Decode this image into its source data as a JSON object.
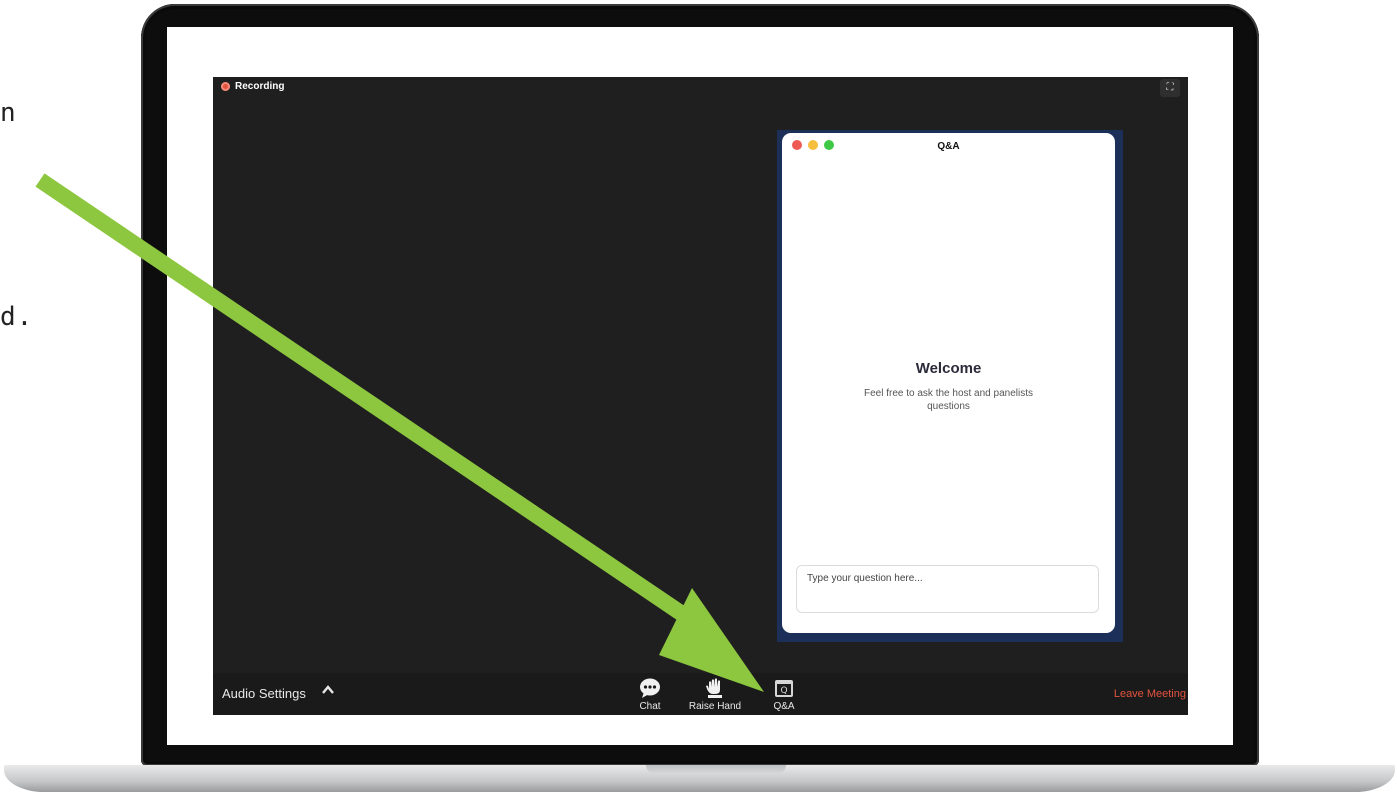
{
  "side_text": {
    "line1": "n",
    "line2": "d."
  },
  "zoom": {
    "recording_label": "Recording",
    "fullscreen_glyph": "⛶",
    "qa_panel": {
      "title": "Q&A",
      "welcome": "Welcome",
      "welcome_sub": "Feel free to ask the host and panelists questions",
      "input_placeholder": "Type your question here...",
      "traffic_colors": [
        "#ee5b55",
        "#f6be3b",
        "#3ec846"
      ]
    },
    "toolbar": {
      "audio_settings": "Audio Settings",
      "caret": "^",
      "chat_label": "Chat",
      "raise_hand_label": "Raise Hand",
      "qa_label": "Q&A",
      "leave_label": "Leave Meeting"
    }
  },
  "colors": {
    "arrow": "#8dc63f",
    "leave": "#e2533f",
    "qa_frame": "#1c2f59"
  }
}
